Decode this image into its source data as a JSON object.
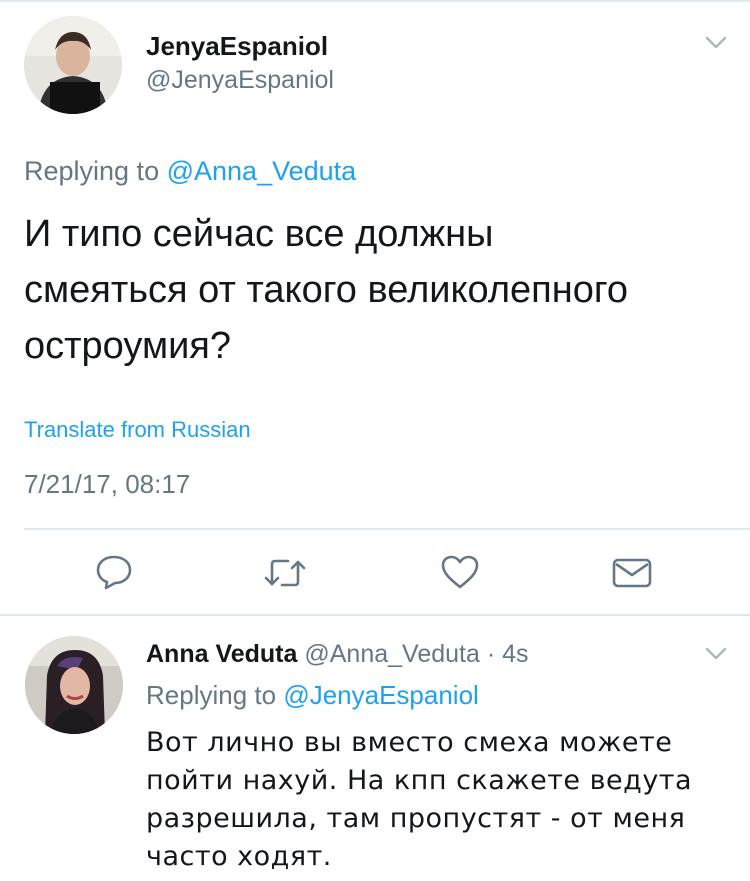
{
  "main_tweet": {
    "display_name": "JenyaEspaniol",
    "handle": "@JenyaEspaniol",
    "replying_prefix": "Replying to",
    "replying_to": "@Anna_Veduta",
    "text_lines": [
      "И типо сейчас все должны",
      "смеяться от такого великолепного",
      "остроумия?"
    ],
    "translate_link": "Translate from Russian",
    "timestamp": "7/21/17, 08:17",
    "actions": [
      "reply-icon",
      "retweet-icon",
      "like-icon",
      "direct-message-icon"
    ]
  },
  "reply_tweet": {
    "display_name": "Anna Veduta",
    "handle": "@Anna_Veduta",
    "separator": "·",
    "time_ago": "4s",
    "replying_prefix": "Replying to",
    "replying_to": "@JenyaEspaniol",
    "text_lines": [
      "Вот лично вы вместо смеха можете",
      "пойти нахуй. На кпп скажете ведута",
      "разрешила, там пропустят - от меня",
      "часто ходят."
    ]
  },
  "colors": {
    "link": "#1da1f2",
    "secondary_text": "#657786",
    "divider": "#e1e8ed",
    "icon_gray": "#657786"
  }
}
